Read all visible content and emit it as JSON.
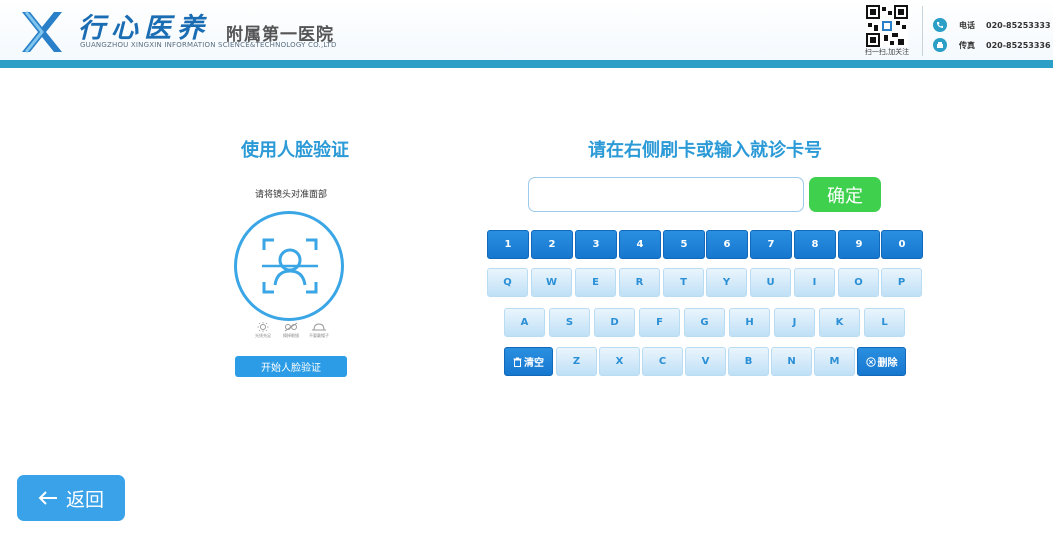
{
  "header": {
    "brand_script": "行心医养",
    "brand_suffix": "附属第一医院",
    "brand_en": "GUANGZHOU XINGXIN INFORMATION SCIENCE&TECHNOLOGY CO.,LTD",
    "qr_caption": "扫一扫,加关注",
    "contacts": [
      {
        "label": "电话",
        "value": "020-85253333",
        "icon": "phone-icon"
      },
      {
        "label": "传真",
        "value": "020-85253336",
        "icon": "fax-icon"
      }
    ],
    "accent": "#2c9fc6"
  },
  "face": {
    "title": "使用人脸验证",
    "hint": "请将镜头对准面部",
    "tips": [
      {
        "label": "光线充足",
        "icon": "light-icon"
      },
      {
        "label": "摘掉眼镜",
        "icon": "no-glasses-icon"
      },
      {
        "label": "不要戴帽子",
        "icon": "no-hat-icon"
      }
    ],
    "start_label": "开始人脸验证"
  },
  "card": {
    "title": "请在右侧刷卡或输入就诊卡号",
    "input_value": "",
    "input_placeholder": "",
    "confirm_label": "确定"
  },
  "keyboard": {
    "numbers": [
      "1",
      "2",
      "3",
      "4",
      "5",
      "6",
      "7",
      "8",
      "9",
      "0"
    ],
    "row1": [
      "Q",
      "W",
      "E",
      "R",
      "T",
      "Y",
      "U",
      "I",
      "O",
      "P"
    ],
    "row2": [
      "A",
      "S",
      "D",
      "F",
      "G",
      "H",
      "J",
      "K",
      "L"
    ],
    "row3": [
      "Z",
      "X",
      "C",
      "V",
      "B",
      "N",
      "M"
    ],
    "clear_label": "清空",
    "delete_label": "删除"
  },
  "nav": {
    "back_label": "返回"
  },
  "colors": {
    "title_blue": "#2b9ad6",
    "confirm_green": "#3fd14e",
    "key_blue": "#1677cf"
  }
}
